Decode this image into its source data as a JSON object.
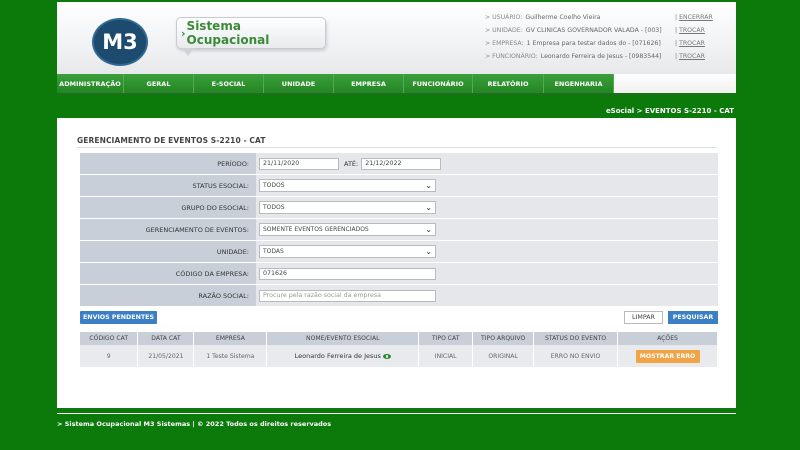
{
  "header": {
    "logo_text": "M3",
    "system_title": "Sistema Ocupacional",
    "info": [
      {
        "label": "USUÁRIO:",
        "value": "Guilherme Coelho Vieira",
        "action": "ENCERRAR"
      },
      {
        "label": "UNIDADE:",
        "value": "GV CLÍNICAS GOVERNADOR VALADA - [003]",
        "action": "TROCAR"
      },
      {
        "label": "EMPRESA:",
        "value": "1 Empresa para testar dados do - [071626]",
        "action": "TROCAR"
      },
      {
        "label": "FUNCIONÁRIO:",
        "value": "Leonardo Ferreira de Jesus - [0983544]",
        "action": "TROCAR"
      }
    ]
  },
  "nav": [
    "ADMINISTRAÇÃO",
    "GERAL",
    "E-SOCIAL",
    "UNIDADE",
    "EMPRESA",
    "FUNCIONÁRIO",
    "RELATÓRIO",
    "ENGENHARIA"
  ],
  "breadcrumb": "eSocial > EVENTOS S-2210 - CAT",
  "panel": {
    "title": "GERENCIAMENTO DE EVENTOS S-2210 - CAT",
    "periodo_label": "PERÍODO:",
    "periodo_de": "21/11/2020",
    "ate_label": "ATÉ:",
    "periodo_ate": "21/12/2022",
    "status_label": "STATUS ESOCIAL:",
    "status_value": "TODOS",
    "grupo_label": "GRUPO DO ESOCIAL:",
    "grupo_value": "TODOS",
    "gerenc_label": "GERENCIAMENTO DE EVENTOS:",
    "gerenc_value": "SOMENTE EVENTOS GERENCIADOS",
    "unidade_label": "UNIDADE:",
    "unidade_value": "TODAS",
    "codigo_label": "CÓDIGO DA EMPRESA:",
    "codigo_value": "071626",
    "razao_label": "RAZÃO SOCIAL:",
    "razao_placeholder": "Procure pela razão social da empresa"
  },
  "buttons": {
    "pendentes": "ENVIOS PENDENTES",
    "limpar": "LIMPAR",
    "pesquisar": "PESQUISAR"
  },
  "table": {
    "headers": [
      "CÓDIGO CAT",
      "DATA CAT",
      "EMPRESA",
      "NOME/EVENTO ESOCIAL",
      "TIPO CAT",
      "TIPO ARQUIVO",
      "STATUS DO EVENTO",
      "AÇÕES"
    ],
    "rows": [
      {
        "codigo": "9",
        "data": "21/05/2021",
        "empresa": "1 Teste Sistema",
        "nome": "Leonardo Ferreira de Jesus",
        "tipo_cat": "INICIAL",
        "tipo_arquivo": "ORIGINAL",
        "status": "ERRO NO ENVIO",
        "acao": "MOSTRAR ERRO"
      }
    ]
  },
  "footer": "> Sistema Ocupacional M3 Sistemas | © 2022 Todos os direitos reservados",
  "colors": {
    "background": "#0b7a0b",
    "nav": "#2a8c2a",
    "primary_button": "#3b7fc4",
    "warning_button": "#f0a445"
  }
}
